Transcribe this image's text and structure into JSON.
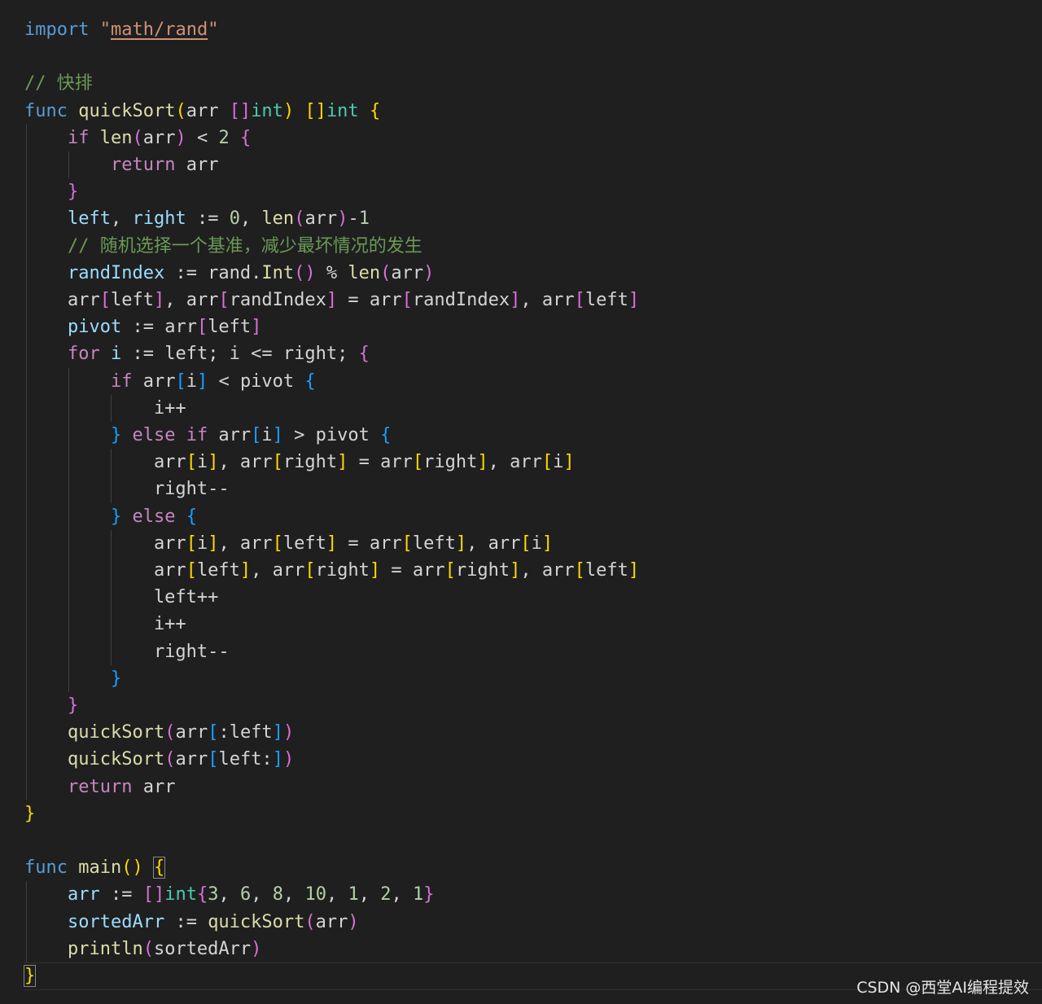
{
  "editor": {
    "background": "#1f1f1f",
    "lines": [
      [
        [
          "kw",
          "import"
        ],
        [
          "p",
          " "
        ],
        [
          "str",
          "\""
        ],
        [
          "strlink",
          "math/rand"
        ],
        [
          "str",
          "\""
        ]
      ],
      [],
      [
        [
          "cmt",
          "// 快排"
        ]
      ],
      [
        [
          "kw",
          "func"
        ],
        [
          "p",
          " "
        ],
        [
          "fn",
          "quickSort"
        ],
        [
          "b1",
          "("
        ],
        [
          "p",
          "arr "
        ],
        [
          "b2",
          "[]"
        ],
        [
          "type",
          "int"
        ],
        [
          "b1",
          ")"
        ],
        [
          "p",
          " "
        ],
        [
          "b1",
          "[]"
        ],
        [
          "type",
          "int"
        ],
        [
          "p",
          " "
        ],
        [
          "b1",
          "{"
        ]
      ],
      [
        [
          "p",
          "    "
        ],
        [
          "ctl",
          "if"
        ],
        [
          "p",
          " "
        ],
        [
          "fn",
          "len"
        ],
        [
          "b2",
          "("
        ],
        [
          "p",
          "arr"
        ],
        [
          "b2",
          ")"
        ],
        [
          "p",
          " < "
        ],
        [
          "num",
          "2"
        ],
        [
          "p",
          " "
        ],
        [
          "b2",
          "{"
        ]
      ],
      [
        [
          "p",
          "        "
        ],
        [
          "ctl",
          "return"
        ],
        [
          "p",
          " arr"
        ]
      ],
      [
        [
          "p",
          "    "
        ],
        [
          "b2",
          "}"
        ]
      ],
      [
        [
          "p",
          "    "
        ],
        [
          "var",
          "left"
        ],
        [
          "p",
          ", "
        ],
        [
          "var",
          "right"
        ],
        [
          "p",
          " := "
        ],
        [
          "num",
          "0"
        ],
        [
          "p",
          ", "
        ],
        [
          "fn",
          "len"
        ],
        [
          "b2",
          "("
        ],
        [
          "p",
          "arr"
        ],
        [
          "b2",
          ")"
        ],
        [
          "p",
          "-"
        ],
        [
          "num",
          "1"
        ]
      ],
      [
        [
          "p",
          "    "
        ],
        [
          "cmt",
          "// 随机选择一个基准，减少最坏情况的发生"
        ]
      ],
      [
        [
          "p",
          "    "
        ],
        [
          "var",
          "randIndex"
        ],
        [
          "p",
          " := rand."
        ],
        [
          "fn",
          "Int"
        ],
        [
          "b2",
          "()"
        ],
        [
          "p",
          " % "
        ],
        [
          "fn",
          "len"
        ],
        [
          "b2",
          "("
        ],
        [
          "p",
          "arr"
        ],
        [
          "b2",
          ")"
        ]
      ],
      [
        [
          "p",
          "    arr"
        ],
        [
          "b2",
          "["
        ],
        [
          "p",
          "left"
        ],
        [
          "b2",
          "]"
        ],
        [
          "p",
          ", arr"
        ],
        [
          "b2",
          "["
        ],
        [
          "p",
          "randIndex"
        ],
        [
          "b2",
          "]"
        ],
        [
          "p",
          " = arr"
        ],
        [
          "b2",
          "["
        ],
        [
          "p",
          "randIndex"
        ],
        [
          "b2",
          "]"
        ],
        [
          "p",
          ", arr"
        ],
        [
          "b2",
          "["
        ],
        [
          "p",
          "left"
        ],
        [
          "b2",
          "]"
        ]
      ],
      [
        [
          "p",
          "    "
        ],
        [
          "var",
          "pivot"
        ],
        [
          "p",
          " := arr"
        ],
        [
          "b2",
          "["
        ],
        [
          "p",
          "left"
        ],
        [
          "b2",
          "]"
        ]
      ],
      [
        [
          "p",
          "    "
        ],
        [
          "ctl",
          "for"
        ],
        [
          "p",
          " "
        ],
        [
          "var",
          "i"
        ],
        [
          "p",
          " := left; i <= right; "
        ],
        [
          "b2",
          "{"
        ]
      ],
      [
        [
          "p",
          "        "
        ],
        [
          "ctl",
          "if"
        ],
        [
          "p",
          " arr"
        ],
        [
          "b3",
          "["
        ],
        [
          "p",
          "i"
        ],
        [
          "b3",
          "]"
        ],
        [
          "p",
          " < pivot "
        ],
        [
          "b3",
          "{"
        ]
      ],
      [
        [
          "p",
          "            i++"
        ]
      ],
      [
        [
          "p",
          "        "
        ],
        [
          "b3",
          "}"
        ],
        [
          "p",
          " "
        ],
        [
          "ctl",
          "else if"
        ],
        [
          "p",
          " arr"
        ],
        [
          "b3",
          "["
        ],
        [
          "p",
          "i"
        ],
        [
          "b3",
          "]"
        ],
        [
          "p",
          " > pivot "
        ],
        [
          "b3",
          "{"
        ]
      ],
      [
        [
          "p",
          "            arr"
        ],
        [
          "b1",
          "["
        ],
        [
          "p",
          "i"
        ],
        [
          "b1",
          "]"
        ],
        [
          "p",
          ", arr"
        ],
        [
          "b1",
          "["
        ],
        [
          "p",
          "right"
        ],
        [
          "b1",
          "]"
        ],
        [
          "p",
          " = arr"
        ],
        [
          "b1",
          "["
        ],
        [
          "p",
          "right"
        ],
        [
          "b1",
          "]"
        ],
        [
          "p",
          ", arr"
        ],
        [
          "b1",
          "["
        ],
        [
          "p",
          "i"
        ],
        [
          "b1",
          "]"
        ]
      ],
      [
        [
          "p",
          "            right--"
        ]
      ],
      [
        [
          "p",
          "        "
        ],
        [
          "b3",
          "}"
        ],
        [
          "p",
          " "
        ],
        [
          "ctl",
          "else"
        ],
        [
          "p",
          " "
        ],
        [
          "b3",
          "{"
        ]
      ],
      [
        [
          "p",
          "            arr"
        ],
        [
          "b1",
          "["
        ],
        [
          "p",
          "i"
        ],
        [
          "b1",
          "]"
        ],
        [
          "p",
          ", arr"
        ],
        [
          "b1",
          "["
        ],
        [
          "p",
          "left"
        ],
        [
          "b1",
          "]"
        ],
        [
          "p",
          " = arr"
        ],
        [
          "b1",
          "["
        ],
        [
          "p",
          "left"
        ],
        [
          "b1",
          "]"
        ],
        [
          "p",
          ", arr"
        ],
        [
          "b1",
          "["
        ],
        [
          "p",
          "i"
        ],
        [
          "b1",
          "]"
        ]
      ],
      [
        [
          "p",
          "            arr"
        ],
        [
          "b1",
          "["
        ],
        [
          "p",
          "left"
        ],
        [
          "b1",
          "]"
        ],
        [
          "p",
          ", arr"
        ],
        [
          "b1",
          "["
        ],
        [
          "p",
          "right"
        ],
        [
          "b1",
          "]"
        ],
        [
          "p",
          " = arr"
        ],
        [
          "b1",
          "["
        ],
        [
          "p",
          "right"
        ],
        [
          "b1",
          "]"
        ],
        [
          "p",
          ", arr"
        ],
        [
          "b1",
          "["
        ],
        [
          "p",
          "left"
        ],
        [
          "b1",
          "]"
        ]
      ],
      [
        [
          "p",
          "            left++"
        ]
      ],
      [
        [
          "p",
          "            i++"
        ]
      ],
      [
        [
          "p",
          "            right--"
        ]
      ],
      [
        [
          "p",
          "        "
        ],
        [
          "b3",
          "}"
        ]
      ],
      [
        [
          "p",
          "    "
        ],
        [
          "b2",
          "}"
        ]
      ],
      [
        [
          "p",
          "    "
        ],
        [
          "fn",
          "quickSort"
        ],
        [
          "b2",
          "("
        ],
        [
          "p",
          "arr"
        ],
        [
          "b3",
          "["
        ],
        [
          "p",
          ":left"
        ],
        [
          "b3",
          "]"
        ],
        [
          "b2",
          ")"
        ]
      ],
      [
        [
          "p",
          "    "
        ],
        [
          "fn",
          "quickSort"
        ],
        [
          "b2",
          "("
        ],
        [
          "p",
          "arr"
        ],
        [
          "b3",
          "["
        ],
        [
          "p",
          "left:"
        ],
        [
          "b3",
          "]"
        ],
        [
          "b2",
          ")"
        ]
      ],
      [
        [
          "p",
          "    "
        ],
        [
          "ctl",
          "return"
        ],
        [
          "p",
          " arr"
        ]
      ],
      [
        [
          "b1",
          "}"
        ]
      ],
      [],
      [
        [
          "kw",
          "func"
        ],
        [
          "p",
          " "
        ],
        [
          "fn",
          "main"
        ],
        [
          "b1",
          "()"
        ],
        [
          "p",
          " "
        ],
        [
          "b1m",
          "{"
        ]
      ],
      [
        [
          "p",
          "    "
        ],
        [
          "var",
          "arr"
        ],
        [
          "p",
          " := "
        ],
        [
          "b2",
          "[]"
        ],
        [
          "type",
          "int"
        ],
        [
          "b2",
          "{"
        ],
        [
          "num",
          "3"
        ],
        [
          "p",
          ", "
        ],
        [
          "num",
          "6"
        ],
        [
          "p",
          ", "
        ],
        [
          "num",
          "8"
        ],
        [
          "p",
          ", "
        ],
        [
          "num",
          "10"
        ],
        [
          "p",
          ", "
        ],
        [
          "num",
          "1"
        ],
        [
          "p",
          ", "
        ],
        [
          "num",
          "2"
        ],
        [
          "p",
          ", "
        ],
        [
          "num",
          "1"
        ],
        [
          "b2",
          "}"
        ]
      ],
      [
        [
          "p",
          "    "
        ],
        [
          "var",
          "sortedArr"
        ],
        [
          "p",
          " := "
        ],
        [
          "fn",
          "quickSort"
        ],
        [
          "b2",
          "("
        ],
        [
          "p",
          "arr"
        ],
        [
          "b2",
          ")"
        ]
      ],
      [
        [
          "p",
          "    "
        ],
        [
          "fn",
          "println"
        ],
        [
          "b2",
          "("
        ],
        [
          "p",
          "sortedArr"
        ],
        [
          "b2",
          ")"
        ]
      ],
      [
        [
          "b1m",
          "}"
        ]
      ]
    ]
  },
  "watermark": "CSDN @西堂AI编程提效"
}
